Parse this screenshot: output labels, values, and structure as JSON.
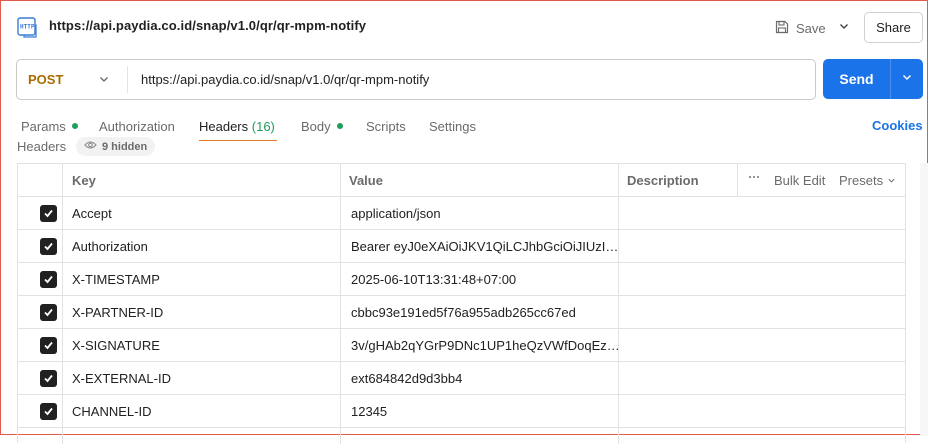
{
  "top": {
    "title": "https://api.paydia.co.id/snap/v1.0/qr/qr-mpm-notify",
    "save_label": "Save",
    "share_label": "Share"
  },
  "request": {
    "method": "POST",
    "url": "https://api.paydia.co.id/snap/v1.0/qr/qr-mpm-notify",
    "send_label": "Send"
  },
  "tabs": {
    "params": "Params",
    "authorization": "Authorization",
    "headers": "Headers",
    "headers_count": "(16)",
    "body": "Body",
    "scripts": "Scripts",
    "settings": "Settings",
    "cookies": "Cookies"
  },
  "headers_section": {
    "label": "Headers",
    "hidden": "9 hidden"
  },
  "table": {
    "col_key": "Key",
    "col_value": "Value",
    "col_description": "Description",
    "bulk_edit": "Bulk Edit",
    "presets": "Presets",
    "rows": [
      {
        "key": "Accept",
        "value": "application/json"
      },
      {
        "key": "Authorization",
        "value": "Bearer eyJ0eXAiOiJKV1QiLCJhbGciOiJIUzI1N..."
      },
      {
        "key": "X-TIMESTAMP",
        "value": "2025-06-10T13:31:48+07:00"
      },
      {
        "key": "X-PARTNER-ID",
        "value": "cbbc93e191ed5f76a955adb265cc67ed"
      },
      {
        "key": "X-SIGNATURE",
        "value": "3v/gHAb2qYGrP9DNc1UP1heQzVWfDoqEz9..."
      },
      {
        "key": "X-EXTERNAL-ID",
        "value": "ext684842d9d3bb4"
      },
      {
        "key": "CHANNEL-ID",
        "value": "12345"
      }
    ]
  },
  "colors": {
    "accent": "#1a73e8",
    "method": "#a86c00",
    "active_tab": "#e07a2e",
    "dot": "#1e9e5a"
  }
}
